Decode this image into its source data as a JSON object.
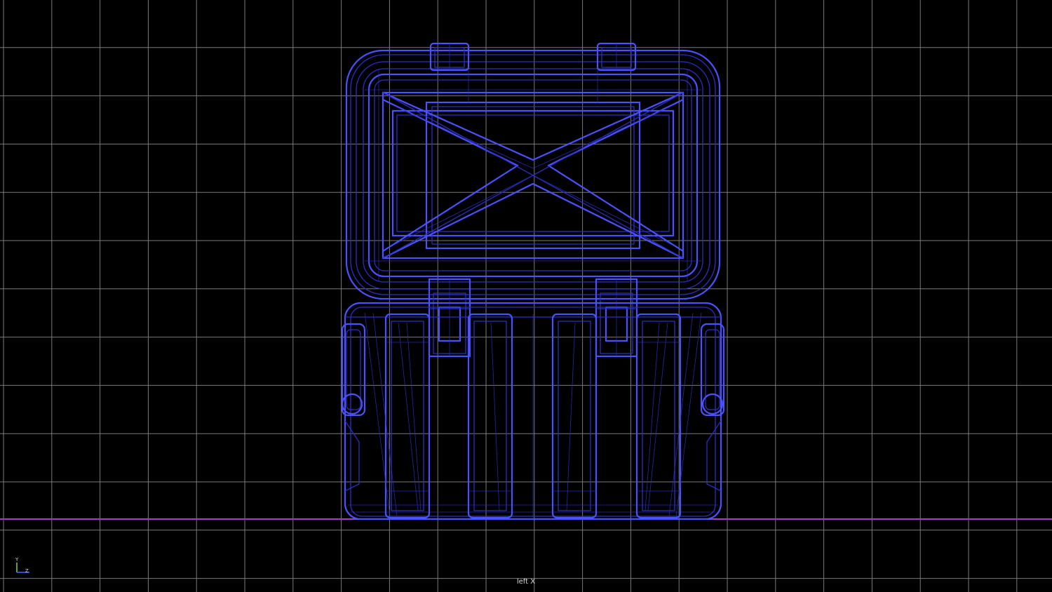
{
  "viewport": {
    "camera_label": "left X",
    "background_color": "#000000",
    "grid_color": "#7a7a7a",
    "ground_line_color": "#9a3fd0",
    "wireframe_color": "#2b2fc4",
    "wireframe_highlight_color": "#4a52ff"
  },
  "axis_gizmo": {
    "y_label": "Y",
    "z_label": "Z",
    "y_color": "#7ddc3c",
    "z_color": "#3c6bff"
  },
  "model": {
    "icon": "wireframe-crate-mesh"
  }
}
